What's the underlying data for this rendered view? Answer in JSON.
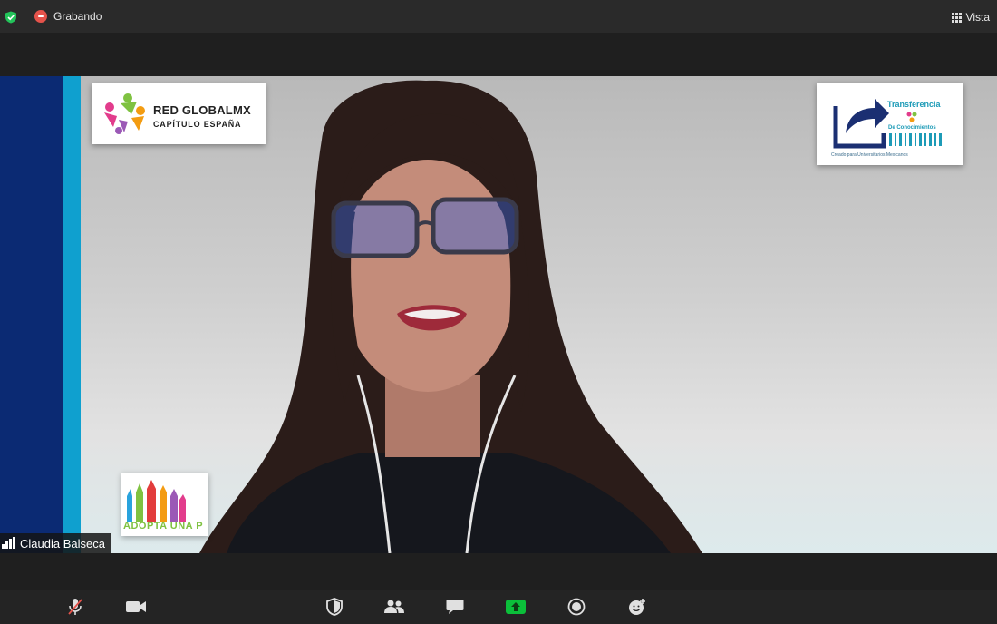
{
  "topbar": {
    "recording_label": "Grabando",
    "view_label": "Vista"
  },
  "video": {
    "participant_name": "Claudia Balseca",
    "logos": {
      "red_global": {
        "line1": "RED GLOBALMX",
        "line2": "CAPÍTULO ESPAÑA"
      },
      "transferencia": {
        "line1": "Transferencia",
        "line2": "De Conocimientos",
        "line3": "Creado para Universitarios Mexicanos"
      },
      "adopta": {
        "text": "ADOPTA UNA P"
      }
    }
  },
  "toolbar": {
    "buttons": [
      "mute-icon",
      "video-icon",
      "security-icon",
      "participants-icon",
      "chat-icon",
      "share-screen-icon",
      "record-icon",
      "reactions-icon"
    ]
  },
  "colors": {
    "navy_stripe": "#0b2a73",
    "cyan_stripe": "#0fa0cf",
    "share_green": "#0bbf3a",
    "record_red": "#e5534b"
  }
}
